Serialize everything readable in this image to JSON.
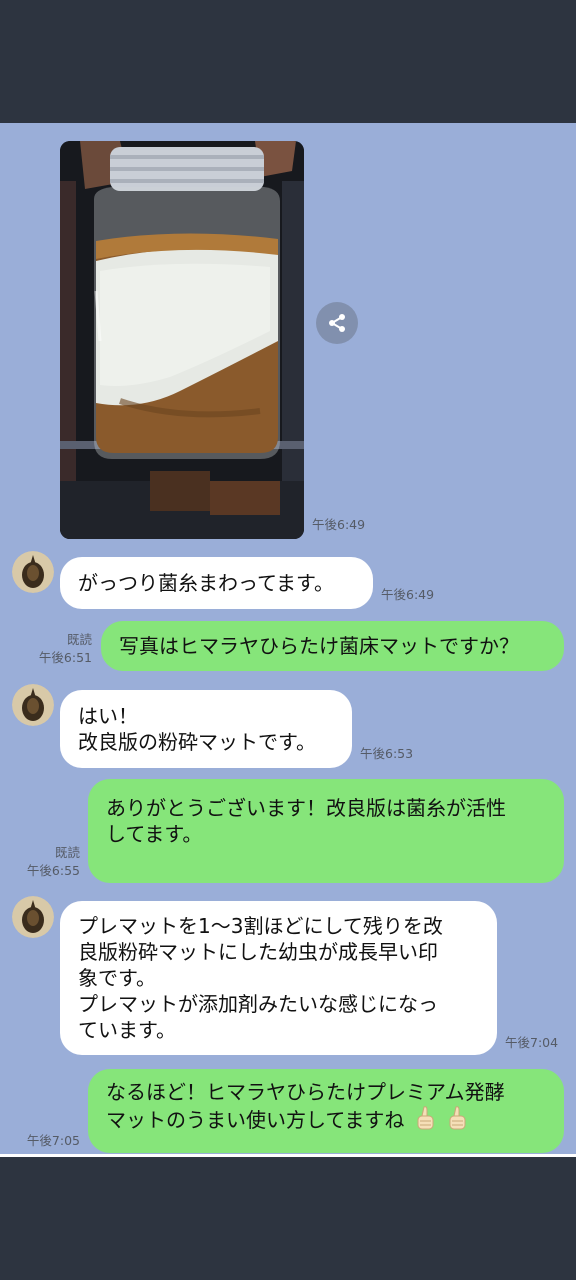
{
  "messages": {
    "photo_time": "午後6:49",
    "m1": {
      "text": "がっつり菌糸まわってます。",
      "time": "午後6:49"
    },
    "m2": {
      "read": "既読",
      "time": "午後6:51",
      "text": "写真はヒマラヤひらたけ菌床マットですか？"
    },
    "m3": {
      "line1": "はい！",
      "line2": "改良版の粉砕マットです。",
      "time": "午後6:53"
    },
    "m4": {
      "read": "既読",
      "time": "午後6:55",
      "line1": "ありがとうございます！改良版は菌糸が活性",
      "line2": "してます。"
    },
    "m5": {
      "line1": "プレマットを1〜3割ほどにして残りを改",
      "line2": "良版粉砕マットにした幼虫が成長早い印",
      "line3": "象です。",
      "line4": "プレマットが添加剤みたいな感じになっ",
      "line5": "ています。",
      "time": "午後7:04"
    },
    "m6": {
      "time": "午後7:05",
      "line1": "なるほど！ヒマラヤひらたけプレミアム発酵",
      "line2": "マットのうまい使い方してますね"
    }
  },
  "icons": {
    "share": "share-icon",
    "avatar": "beetle-avatar",
    "thumbs": "thumbs-up-icon"
  },
  "colors": {
    "chat_bg": "#9aaed8",
    "sent_bubble": "#86e57a",
    "received_bubble": "#ffffff",
    "frame": "#2d3440"
  }
}
